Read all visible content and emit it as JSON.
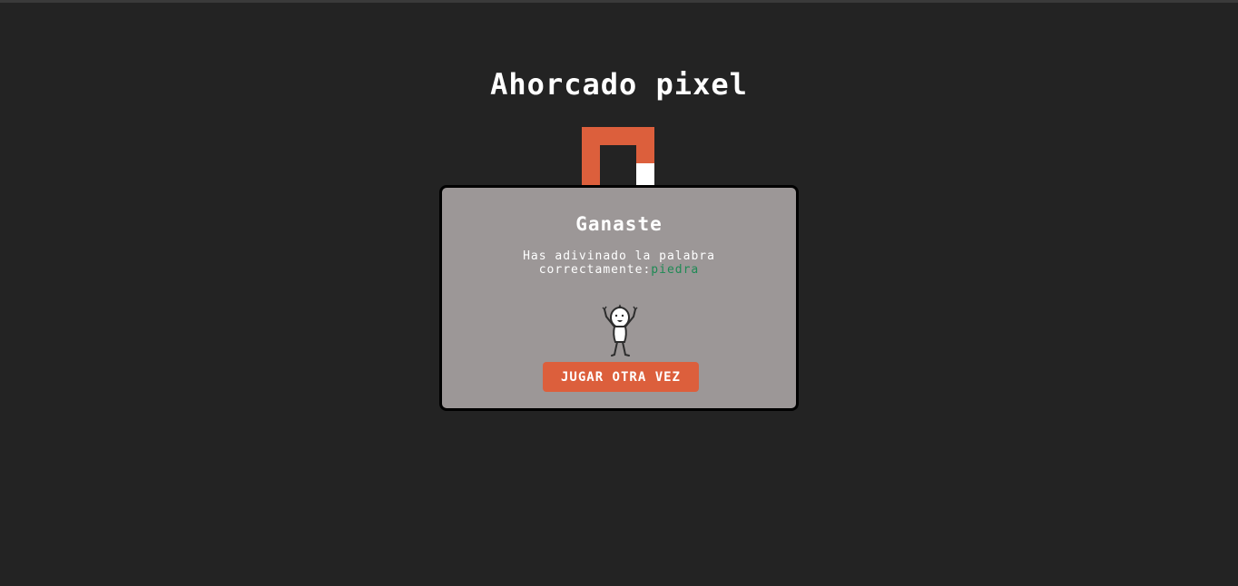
{
  "game": {
    "title": "Ahorcado pixel"
  },
  "modal": {
    "title": "Ganaste",
    "message_line1": "Has adivinado la palabra",
    "message_line2": "correctamente:",
    "word": "piedra",
    "figure_icon": "celebrating-stick-figure-icon",
    "button_label": "JUGAR OTRA VEZ"
  },
  "colors": {
    "background": "#232323",
    "accent": "#dc5f3c",
    "modal_background": "#9c9797",
    "word_color": "#1f8a55",
    "text": "#ffffff"
  }
}
